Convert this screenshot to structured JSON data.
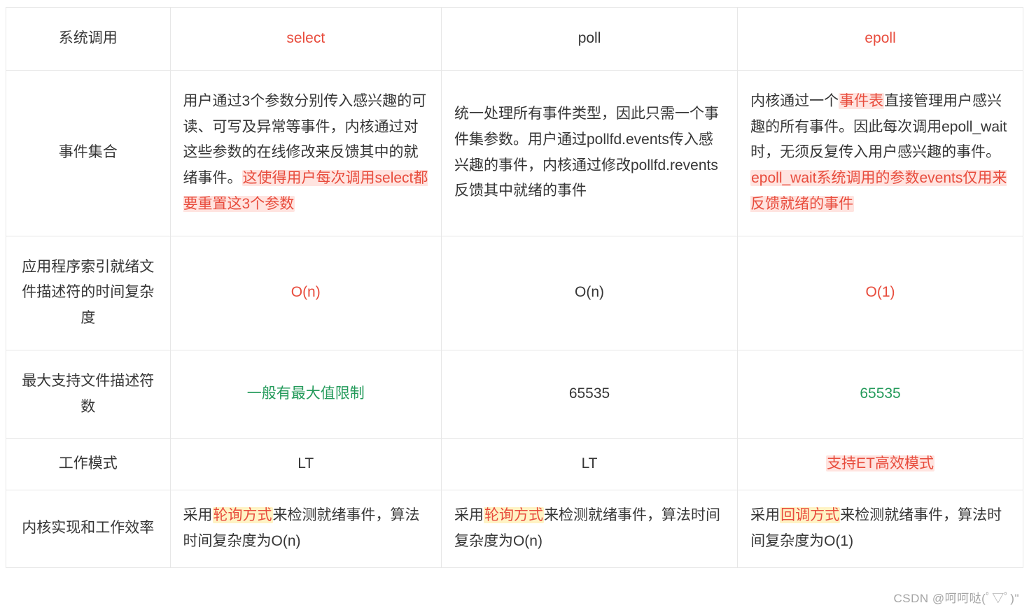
{
  "header": {
    "col0": "系统调用",
    "col1": "select",
    "col2": "poll",
    "col3": "epoll"
  },
  "rows": {
    "event_set": {
      "label": "事件集合",
      "select": {
        "pre": "用户通过3个参数分别传入感兴趣的可读、可写及异常等事件，内核通过对这些参数的在线修改来反馈其中的就绪事件。",
        "hl": "这使得用户每次调用select都要重置这3个参数"
      },
      "poll": "统一处理所有事件类型，因此只需一个事件集参数。用户通过pollfd.events传入感兴趣的事件，内核通过修改pollfd.revents反馈其中就绪的事件",
      "epoll": {
        "p1a": "内核通过一个",
        "p1hl": "事件表",
        "p1b": "直接管理用户感兴趣的所有事件。因此每次调用epoll_wait时，无须反复传入用户感兴趣的事件。",
        "p2hl": "epoll_wait系统调用的参数events仅用来反馈就绪的事件"
      }
    },
    "complexity": {
      "label": "应用程序索引就绪文件描述符的时间复杂度",
      "select": "O(n)",
      "poll": "O(n)",
      "epoll": "O(1)"
    },
    "maxfd": {
      "label": "最大支持文件描述符数",
      "select": "一般有最大值限制",
      "poll": "65535",
      "epoll": "65535"
    },
    "mode": {
      "label": "工作模式",
      "select": "LT",
      "poll": "LT",
      "epoll": "支持ET高效模式"
    },
    "kernel": {
      "label": "内核实现和工作效率",
      "select": {
        "pre": "采用",
        "hl": "轮询方式",
        "post": "来检测就绪事件，算法时间复杂度为O(n)"
      },
      "poll": {
        "pre": "采用",
        "hl": "轮询方式",
        "post": "来检测就绪事件，算法时间复杂度为O(n)"
      },
      "epoll": {
        "pre": "采用",
        "hl": "回调方式",
        "post": "来检测就绪事件，算法时间复杂度为O(1)"
      }
    }
  },
  "watermark": "CSDN @呵呵哒(ﾟ▽ﾟ)\""
}
